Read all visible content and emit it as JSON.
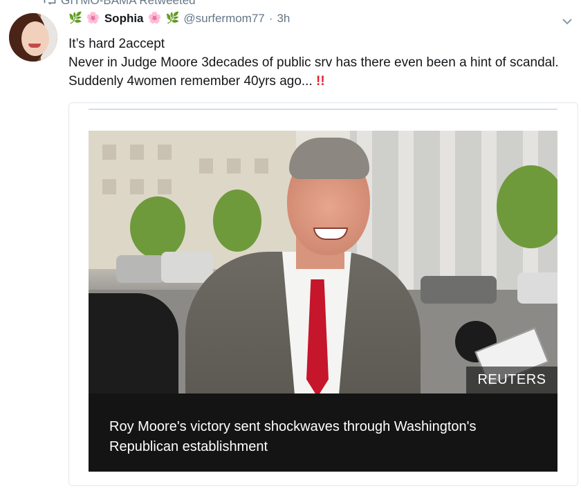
{
  "retweet": {
    "label": "GITMO-BAMA Retweeted"
  },
  "tweet": {
    "display_name": "Sophia",
    "handle": "@surfermom77",
    "separator": "·",
    "time": "3h",
    "line1": "It’s hard 2accept",
    "line2": "Never in Judge Moore 3decades of public srv has there even been a hint of scandal. Suddenly 4women remember 40yrs ago...",
    "emphasis": "!!"
  },
  "card": {
    "watermark": "REUTERS",
    "caption": "Roy Moore's victory sent shockwaves through Washington's Republican establishment"
  },
  "icons": {
    "retweet": "retweet-icon",
    "more": "chevron-down-icon",
    "name_decor_leaf": "herb-emoji",
    "name_decor_flower": "cherry-blossom-emoji"
  },
  "colors": {
    "text": "#14171a",
    "secondary": "#657786",
    "emphasis": "#e0202b",
    "caption_bg": "#141414"
  }
}
